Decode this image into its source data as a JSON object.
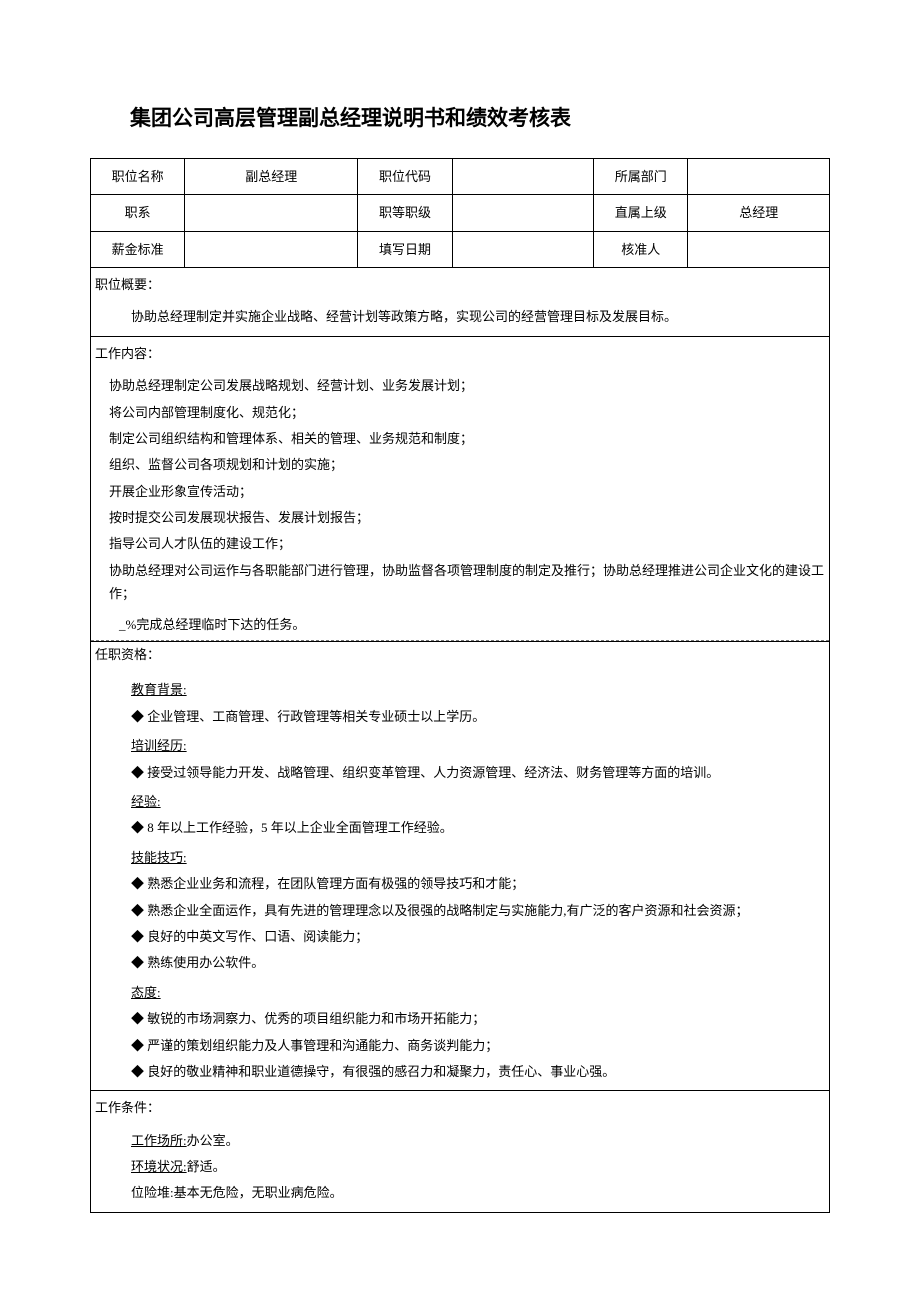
{
  "title": "集团公司高层管理副总经理说明书和绩效考核表",
  "header": {
    "r1c1": "职位名称",
    "r1c2": "副总经理",
    "r1c3": "职位代码",
    "r1c4": "",
    "r1c5": "所属部门",
    "r1c6": "",
    "r2c1": "职系",
    "r2c2": "",
    "r2c3": "职等职级",
    "r2c4": "",
    "r2c5": "直属上级",
    "r2c6": "总经理",
    "r3c1": "薪金标准",
    "r3c2": "",
    "r3c3": "填写日期",
    "r3c4": "",
    "r3c5": "核准人",
    "r3c6": ""
  },
  "overview": {
    "label": "职位概要：",
    "text": "协助总经理制定并实施企业战略、经营计划等政策方略，实现公司的经营管理目标及发展目标。"
  },
  "content": {
    "label": "工作内容：",
    "items": [
      "协助总经理制定公司发展战略规划、经营计划、业务发展计划；",
      "将公司内部管理制度化、规范化；",
      "制定公司组织结构和管理体系、相关的管理、业务规范和制度；",
      "组织、监督公司各项规划和计划的实施；",
      "开展企业形象宣传活动；",
      "按时提交公司发展现状报告、发展计划报告；",
      "指导公司人才队伍的建设工作；",
      "协助总经理对公司运作与各职能部门进行管理，协助监督各项管理制度的制定及推行；协助总经理推进公司企业文化的建设工作；"
    ],
    "last": "_%完成总经理临时下达的任务。"
  },
  "qual": {
    "label": "任职资格：",
    "edu_h": "教育背景:",
    "edu": "◆ 企业管理、工商管理、行政管理等相关专业硕士以上学历。",
    "train_h": "培训经历:",
    "train": "◆ 接受过领导能力开发、战略管理、组织变革管理、人力资源管理、经济法、财务管理等方面的培训。",
    "exp_h": "经验:",
    "exp": "◆ 8 年以上工作经验，5 年以上企业全面管理工作经验。",
    "skill_h": "技能技巧:",
    "skills": [
      "◆ 熟悉企业业务和流程，在团队管理方面有极强的领导技巧和才能；",
      "◆ 熟悉企业全面运作，具有先进的管理理念以及很强的战略制定与实施能力,有广泛的客户资源和社会资源；",
      "◆ 良好的中英文写作、口语、阅读能力；",
      "◆ 熟练使用办公软件。"
    ],
    "att_h": "态度:",
    "atts": [
      "◆ 敏锐的市场洞察力、优秀的项目组织能力和市场开拓能力；",
      "◆ 严谨的策划组织能力及人事管理和沟通能力、商务谈判能力；",
      "◆ 良好的敬业精神和职业道德操守，有很强的感召力和凝聚力，责任心、事业心强。"
    ]
  },
  "cond": {
    "label": "工作条件：",
    "place_h": "工作场所:",
    "place": "办公室。",
    "env_h": "环境状况:",
    "env": "舒适。",
    "risk_h": "位险堆:",
    "risk": "基本无危险，无职业病危险。"
  }
}
